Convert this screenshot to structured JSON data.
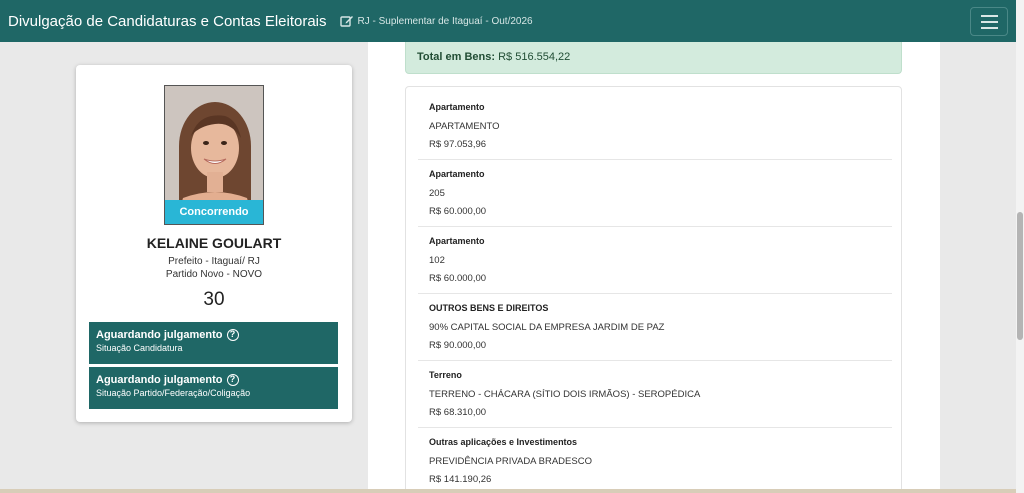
{
  "header": {
    "title": "Divulgação de Candidaturas e Contas Eleitorais",
    "election": "RJ - Suplementar de Itaguaí - Out/2026"
  },
  "candidate": {
    "status": "Concorrendo",
    "name": "KELAINE GOULART",
    "office": "Prefeito - Itaguaí/ RJ",
    "party": "Partido Novo - NOVO",
    "number": "30",
    "situations": [
      {
        "title": "Aguardando julgamento",
        "subtitle": "Situação Candidatura"
      },
      {
        "title": "Aguardando julgamento",
        "subtitle": "Situação Partido/Federação/Coligação"
      }
    ]
  },
  "assets": {
    "total_label": "Total em Bens:",
    "total_value": "R$ 516.554,22",
    "items": [
      {
        "type": "Apartamento",
        "description": "APARTAMENTO",
        "value": "R$ 97.053,96"
      },
      {
        "type": "Apartamento",
        "description": "205",
        "value": "R$ 60.000,00"
      },
      {
        "type": "Apartamento",
        "description": "102",
        "value": "R$ 60.000,00"
      },
      {
        "type": "OUTROS BENS E DIREITOS",
        "description": "90% CAPITAL SOCIAL DA EMPRESA JARDIM DE PAZ",
        "value": "R$ 90.000,00"
      },
      {
        "type": "Terreno",
        "description": "TERRENO - CHÁCARA (SÍTIO DOIS IRMÃOS) - SEROPÉDICA",
        "value": "R$ 68.310,00"
      },
      {
        "type": "Outras aplicações e Investimentos",
        "description": "PREVIDÊNCIA PRIVADA BRADESCO",
        "value": "R$ 141.190,26"
      }
    ]
  },
  "colors": {
    "brand": "#1f6766",
    "status_ribbon": "#29b6d6",
    "total_bg": "#d3ebdd"
  }
}
